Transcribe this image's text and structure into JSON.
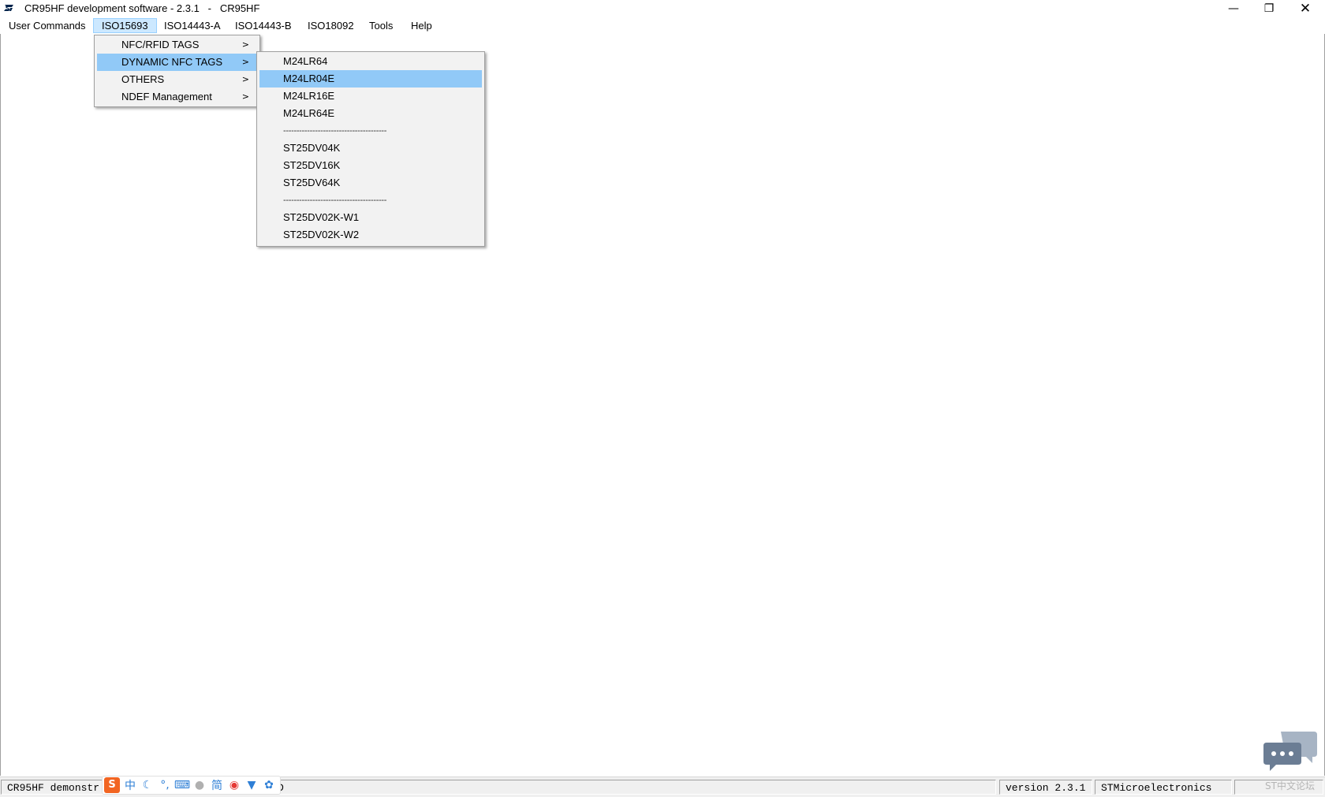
{
  "window": {
    "title": "CR95HF development software - 2.3.1   -   CR95HF",
    "minimize_glyph": "—",
    "maximize_glyph": "❐",
    "close_glyph": "✕"
  },
  "menubar": {
    "items": [
      "User Commands",
      "ISO15693",
      "ISO14443-A",
      "ISO14443-B",
      "ISO18092",
      "Tools",
      "Help"
    ],
    "active": "ISO15693"
  },
  "iso15693_menu": {
    "items": [
      "NFC/RFID TAGS",
      "DYNAMIC NFC TAGS",
      "OTHERS",
      "NDEF Management"
    ],
    "highlighted": "DYNAMIC NFC TAGS",
    "submenu_arrow": ">"
  },
  "dynamic_nfc_submenu": {
    "group1": [
      "M24LR64",
      "M24LR04E",
      "M24LR16E",
      "M24LR64E"
    ],
    "separator": "---------------------------------------",
    "group2": [
      "ST25DV04K",
      "ST25DV16K",
      "ST25DV64K"
    ],
    "group3": [
      "ST25DV02K-W1",
      "ST25DV02K-W2"
    ],
    "highlighted": "M24LR04E"
  },
  "statusbar": {
    "main_left": "CR95HF demonstr",
    "main_right": "D",
    "version": "version 2.3.1",
    "company": "STMicroelectronics"
  },
  "ime_toolbar": {
    "icons": [
      "sogou-logo-icon",
      "chinese-mode-icon",
      "moon-icon",
      "punctuation-icon",
      "keyboard-icon",
      "user-icon",
      "simplified-icon",
      "voice-icon",
      "skin-icon",
      "settings-icon"
    ],
    "chinese_mode": "中",
    "simplified": "简"
  },
  "watermark": {
    "text": "ST中文论坛"
  },
  "colors": {
    "menu_highlight": "#91c9f7",
    "menubar_active": "#cce8ff",
    "popup_bg": "#f2f2f2",
    "st_blue": "#03234b"
  }
}
